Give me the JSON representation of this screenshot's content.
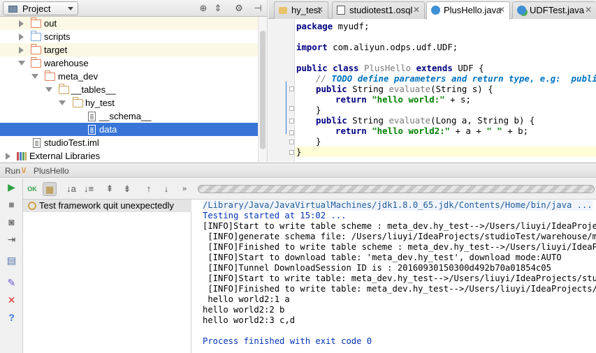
{
  "project": {
    "view_label": "Project",
    "header_icons": [
      "globe-icon",
      "collapse-icon",
      "gear-icon",
      "pin-icon"
    ],
    "tree": [
      {
        "name": "out",
        "icon": "folder-orange",
        "expanded": false,
        "highlight": true
      },
      {
        "name": "scripts",
        "icon": "folder-blue",
        "expanded": false
      },
      {
        "name": "target",
        "icon": "folder-orange",
        "expanded": false,
        "highlight": true
      },
      {
        "name": "warehouse",
        "icon": "folder-orange",
        "expanded": true
      },
      {
        "name": "meta_dev",
        "icon": "folder-orange",
        "expanded": true
      },
      {
        "name": "__tables__",
        "icon": "folder-plain",
        "expanded": true
      },
      {
        "name": "hy_test",
        "icon": "folder-plain",
        "expanded": true
      },
      {
        "name": "__schema__",
        "icon": "file-text"
      },
      {
        "name": "data",
        "icon": "file-text",
        "selected": true
      },
      {
        "name": "studioTest.iml",
        "icon": "file-iml"
      },
      {
        "name": "External Libraries",
        "icon": "library",
        "expanded": false
      }
    ]
  },
  "editor": {
    "tabs": [
      {
        "label": "hy_test",
        "icon": "folder-icon"
      },
      {
        "label": "studiotest1.osql",
        "icon": "sql-file-icon"
      },
      {
        "label": "PlusHello.java",
        "icon": "java-class-icon",
        "active": true
      },
      {
        "label": "UDFTest.java",
        "icon": "java-test-icon"
      }
    ],
    "code": {
      "l1": {
        "kw": "package",
        "rest": " myudf;"
      },
      "l2": {
        "kw": "import",
        "rest": " com.aliyun.odps.udf.UDF;"
      },
      "l3": {
        "kw1": "public class",
        "name": " PlusHello ",
        "kw2": "extends",
        "rest": " UDF {"
      },
      "l4": {
        "c1": "// ",
        "todo": "TODO define parameters and return type, e.g:  public Str"
      },
      "l5": {
        "kw": "public",
        "t": " String ",
        "m": "evaluate",
        "rest": "(String s) {"
      },
      "l6": {
        "kw": "return",
        "s": " \"hello world:\"",
        "rest": " + s;"
      },
      "l7": {
        "rest": "}"
      },
      "l8": {
        "kw": "public",
        "t": " String ",
        "m": "evaluate",
        "rest": "(Long a, String b) {"
      },
      "l9": {
        "kw": "return",
        "s1": " \"hello world2:\"",
        "mid": " + a + ",
        "s2": "\" \"",
        "rest": " + b;"
      },
      "l10": {
        "rest": "}"
      },
      "l11": {
        "rest": "}"
      }
    }
  },
  "run": {
    "label": "Run",
    "config_name": "PlusHello",
    "toolbar_icons": [
      "play-icon",
      "ok-icon",
      "db-icon",
      "sort-alpha-icon",
      "sort-duration-icon",
      "expand-all-icon",
      "collapse-all-icon",
      "up-icon",
      "down-icon",
      "more-icon"
    ],
    "test_tree_item": "Test framework quit unexpectedly",
    "console_lines": [
      "/Library/Java/JavaVirtualMachines/jdk1.8.0_65.jdk/Contents/Home/bin/java ...",
      "Testing started at 15:02 ...",
      "[INFO]Start to write table scheme : meta_dev.hy_test-->/Users/liuyi/IdeaProjects/",
      " [INFO]generate schema file: /Users/liuyi/IdeaProjects/studioTest/warehouse/meta_",
      " [INFO]Finished to write table scheme : meta_dev.hy_test-->/Users/liuyi/IdeaProje",
      " [INFO]Start to download table: 'meta_dev.hy_test', download mode:AUTO",
      " [INFO]Tunnel DownloadSession ID is : 20160930150300d492b70a01854c05",
      " [INFO]Start to write table: meta_dev.hy_test-->/Users/liuyi/IdeaProjects/studioT",
      " [INFO]Finished to write table: meta_dev.hy_test-->/Users/liuyi/IdeaProjects/studioT",
      " hello world2:1 a",
      "hello world2:2 b",
      "hello world2:3 c,d",
      "",
      "Process finished with exit code 0"
    ]
  }
}
